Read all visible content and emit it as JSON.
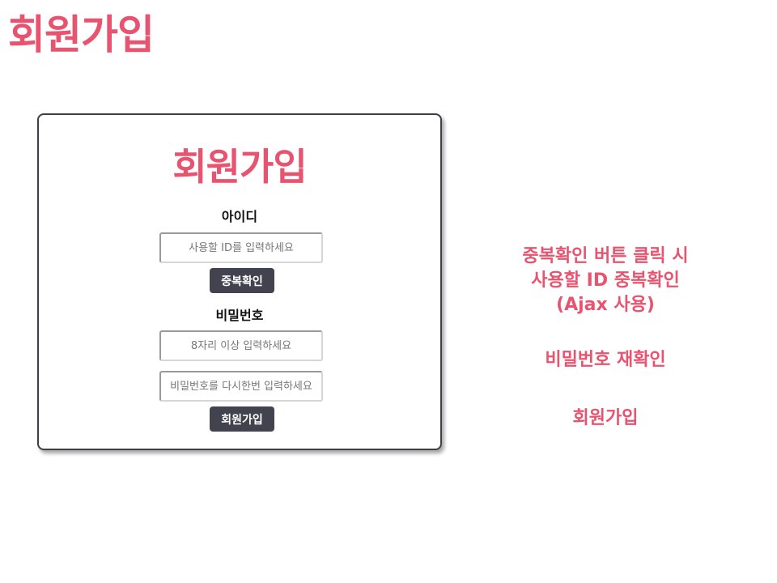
{
  "page": {
    "heading": "회원가입"
  },
  "form": {
    "title": "회원가입",
    "id_label": "아이디",
    "id_placeholder": "사용할 ID를 입력하세요",
    "id_value": "",
    "dup_check_button": "중복확인",
    "password_label": "비밀번호",
    "password_placeholder": "8자리 이상 입력하세요",
    "password_value": "",
    "password_confirm_placeholder": "비밀번호를 다시한번 입력하세요",
    "password_confirm_value": "",
    "signup_button": "회원가입"
  },
  "annotations": {
    "dup_check_note": "중복확인 버튼 클릭 시\n사용할 ID 중복확인\n(Ajax 사용)",
    "password_note": "비밀번호 재확인",
    "signup_note": "회원가입"
  },
  "colors": {
    "accent": "#e8546f",
    "button_bg": "#434350",
    "button_text": "#ffffff",
    "card_border": "#3e3e48"
  }
}
